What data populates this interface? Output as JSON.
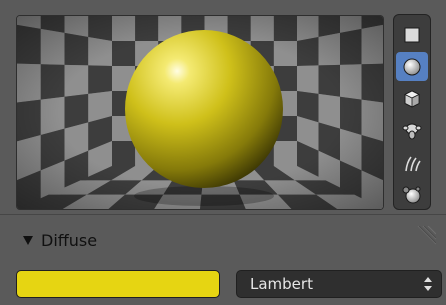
{
  "preview": {
    "sphere_color": "#e3d418",
    "checker_dark": "#3d3d3d",
    "checker_light": "#8f8f8f"
  },
  "preview_types": [
    {
      "icon": "flat-icon",
      "active": false
    },
    {
      "icon": "sphere-icon",
      "active": true
    },
    {
      "icon": "cube-icon",
      "active": false
    },
    {
      "icon": "monkey-icon",
      "active": false
    },
    {
      "icon": "hair-icon",
      "active": false
    },
    {
      "icon": "sphere-a-icon",
      "active": false
    }
  ],
  "diffuse": {
    "title": "Diffuse",
    "color": "#e6d512",
    "shader": "Lambert"
  },
  "colors": {
    "active": "#5680c2",
    "background": "#5a5a5a"
  }
}
